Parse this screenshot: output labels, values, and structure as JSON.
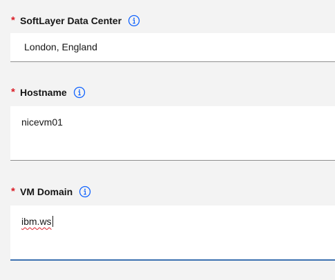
{
  "fields": [
    {
      "label": "SoftLayer Data Center",
      "required_marker": "*",
      "value": "London, England",
      "info_icon": "info-icon"
    },
    {
      "label": "Hostname",
      "required_marker": "*",
      "value": "nicevm01",
      "info_icon": "info-icon"
    },
    {
      "label": "VM Domain",
      "required_marker": "*",
      "value": "ibm.ws",
      "info_icon": "info-icon",
      "focused": true
    }
  ],
  "colors": {
    "required": "#da1e28",
    "focus_border": "#3a6fb0",
    "info_icon": "#0f62fe",
    "background": "#f3f3f3",
    "field_background": "#ffffff"
  }
}
